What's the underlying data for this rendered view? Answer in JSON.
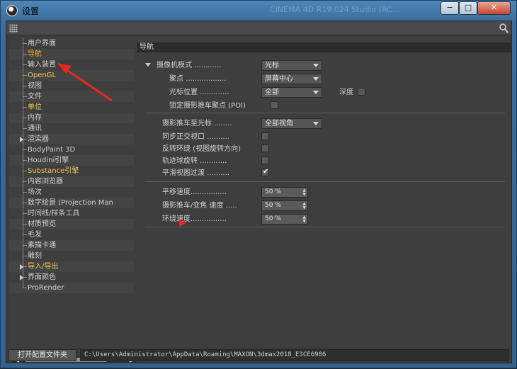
{
  "window": {
    "title": "设置",
    "ghost_title": "CINEMA 4D R19.024 Studio (RC...",
    "min_label": "−",
    "max_label": "□",
    "close_label": "✕"
  },
  "sidebar": {
    "items": [
      {
        "label": "用户界面",
        "state": "normal",
        "arrow": false
      },
      {
        "label": "导航",
        "state": "selected",
        "arrow": false
      },
      {
        "label": "输入装置",
        "state": "normal",
        "arrow": false
      },
      {
        "label": "OpenGL",
        "state": "highlight",
        "arrow": false
      },
      {
        "label": "视图",
        "state": "normal",
        "arrow": false
      },
      {
        "label": "文件",
        "state": "normal",
        "arrow": false
      },
      {
        "label": "单位",
        "state": "highlight",
        "arrow": false
      },
      {
        "label": "内存",
        "state": "normal",
        "arrow": false
      },
      {
        "label": "通讯",
        "state": "normal",
        "arrow": false
      },
      {
        "label": "渲染器",
        "state": "normal",
        "arrow": true
      },
      {
        "label": "BodyPaint 3D",
        "state": "normal",
        "arrow": false
      },
      {
        "label": "Houdini引擎",
        "state": "normal",
        "arrow": false
      },
      {
        "label": "Substance引擎",
        "state": "highlight",
        "arrow": false
      },
      {
        "label": "内容浏览器",
        "state": "normal",
        "arrow": false
      },
      {
        "label": "场次",
        "state": "normal",
        "arrow": false
      },
      {
        "label": "数字绘景 (Projection Man",
        "state": "normal",
        "arrow": false
      },
      {
        "label": "时间线/样条工具",
        "state": "normal",
        "arrow": false
      },
      {
        "label": "材质预览",
        "state": "normal",
        "arrow": false
      },
      {
        "label": "毛发",
        "state": "normal",
        "arrow": false
      },
      {
        "label": "素描卡通",
        "state": "normal",
        "arrow": false
      },
      {
        "label": "雕刻",
        "state": "normal",
        "arrow": false
      },
      {
        "label": "导入/导出",
        "state": "highlight",
        "arrow": true
      },
      {
        "label": "界面颜色",
        "state": "normal",
        "arrow": true
      },
      {
        "label": "ProRender",
        "state": "normal",
        "arrow": false
      }
    ]
  },
  "panel": {
    "header": "导航",
    "camera_mode_label": "摄像机模式 ............",
    "camera_mode_value": "光标",
    "focus_label": "聚点 ..................",
    "focus_value": "屏幕中心",
    "cursor_pos_label": "光标位置 .............",
    "cursor_pos_value": "全部",
    "depth_label": "深度",
    "depth_checked": false,
    "lock_poi_label": "锁定摄影推车聚点 (POI)",
    "lock_poi_checked": false,
    "dolly_label": "摄影推车至光标 ........",
    "dolly_value": "全部视角",
    "sync_label": "同步正交视口 ..........",
    "sync_checked": false,
    "reverse_label": "反转环绕 (视图旋转方向)",
    "reverse_checked": false,
    "trackball_label": "轨迹球旋转 ............",
    "trackball_checked": false,
    "smooth_label": "平滑视图过渡 ..........",
    "smooth_checked": true,
    "pan_speed_label": "平移速度................",
    "pan_speed_value": "50 %",
    "dolly_speed_label": "摄影推车/变焦 速度 .....",
    "dolly_speed_value": "50 %",
    "orbit_speed_label": "环绕速度................",
    "orbit_speed_value": "50 %"
  },
  "footer": {
    "open_config_label": "打开配置文件夹",
    "path": "C:\\Users\\Administrator\\AppData\\Roaming\\MAXON\\3dmax2018_E3CE6986"
  },
  "annotation": {
    "color": "#e8281e"
  }
}
